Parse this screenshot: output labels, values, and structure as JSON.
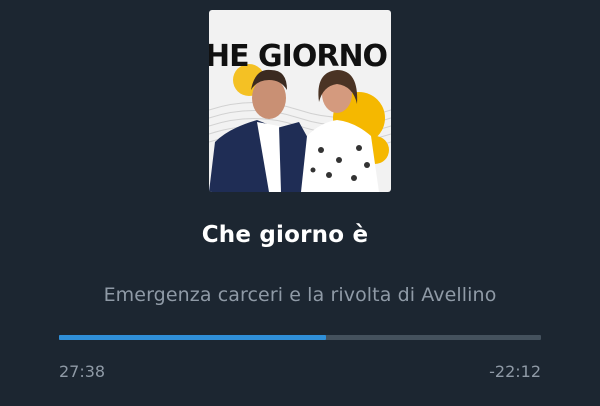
{
  "cover": {
    "text": "CHE GIORNO È",
    "colors": {
      "background": "#f2f2f2",
      "accent": "#f5b800",
      "ink": "#111111"
    }
  },
  "episode": {
    "show_title": "Che giorno è",
    "episode_title": "Emergenza carceri e la rivolta di Avellino"
  },
  "playback": {
    "elapsed": "27:38",
    "remaining": "-22:12",
    "progress_fraction": 0.5547
  },
  "colors": {
    "background": "#1c2631",
    "progress": "#2f8fd8",
    "track": "#44515d"
  }
}
